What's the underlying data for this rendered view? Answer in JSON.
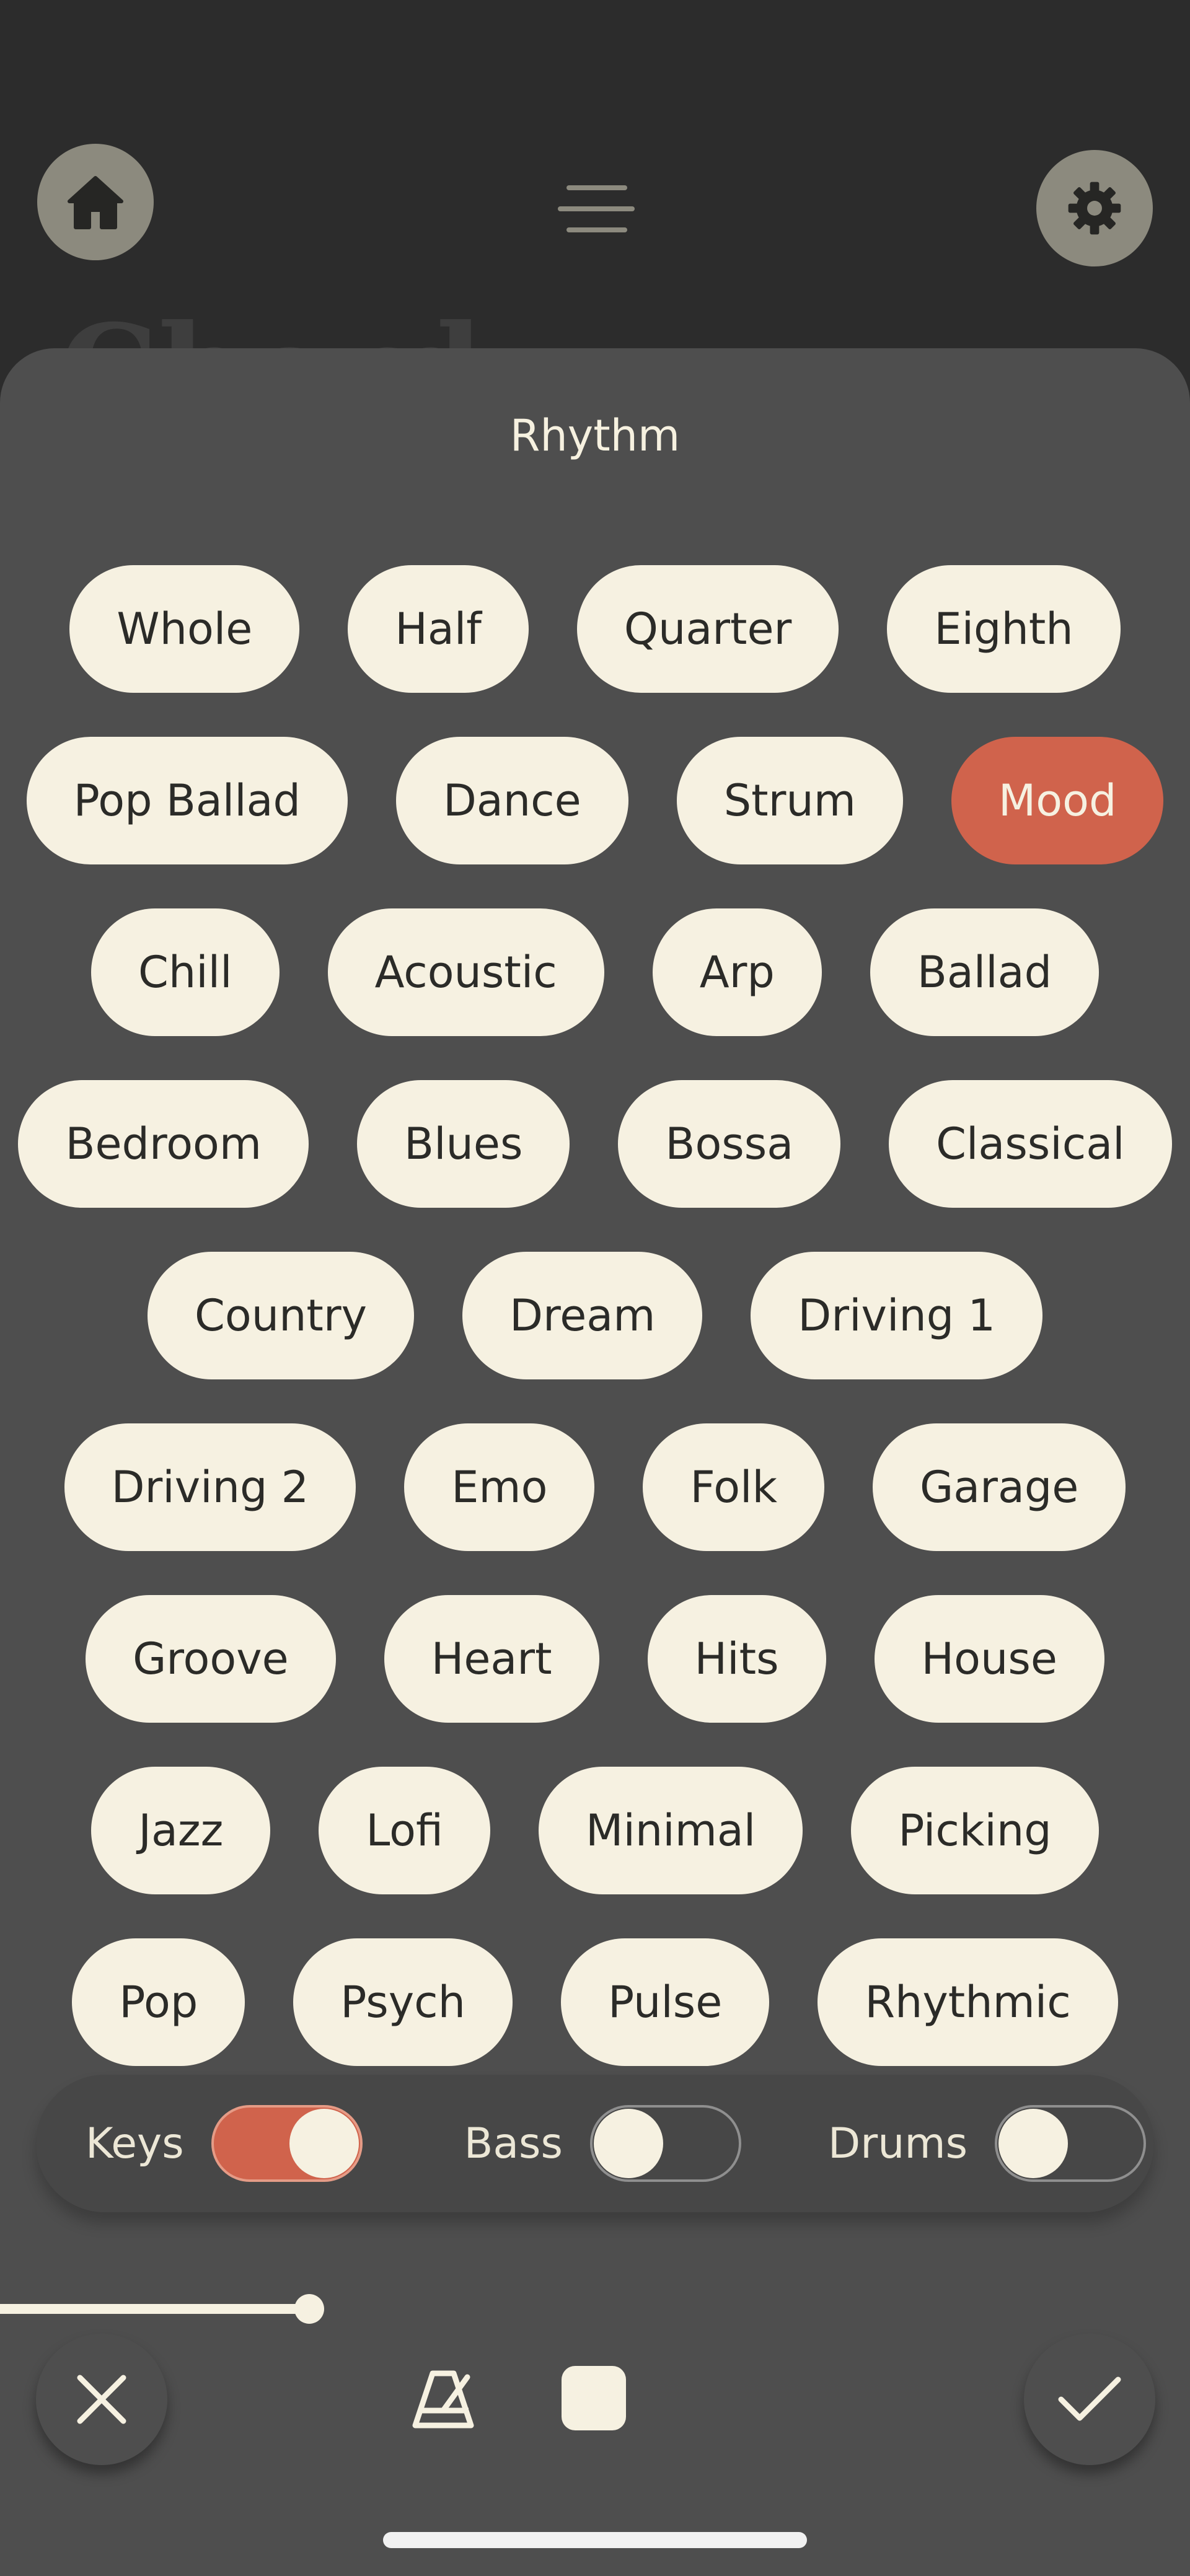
{
  "header": {
    "home_icon": "home-icon",
    "menu_icon": "hamburger-menu-icon",
    "settings_icon": "gear-icon",
    "background_title": "Chord"
  },
  "sheet": {
    "title": "Rhythm",
    "rows": [
      [
        {
          "label": "Whole",
          "selected": false
        },
        {
          "label": "Half",
          "selected": false
        },
        {
          "label": "Quarter",
          "selected": false
        },
        {
          "label": "Eighth",
          "selected": false
        }
      ],
      [
        {
          "label": "Pop Ballad",
          "selected": false
        },
        {
          "label": "Dance",
          "selected": false
        },
        {
          "label": "Strum",
          "selected": false
        },
        {
          "label": "Mood",
          "selected": true
        }
      ],
      [
        {
          "label": "Chill",
          "selected": false
        },
        {
          "label": "Acoustic",
          "selected": false
        },
        {
          "label": "Arp",
          "selected": false
        },
        {
          "label": "Ballad",
          "selected": false
        }
      ],
      [
        {
          "label": "Bedroom",
          "selected": false
        },
        {
          "label": "Blues",
          "selected": false
        },
        {
          "label": "Bossa",
          "selected": false
        },
        {
          "label": "Classical",
          "selected": false
        }
      ],
      [
        {
          "label": "Country",
          "selected": false
        },
        {
          "label": "Dream",
          "selected": false
        },
        {
          "label": "Driving 1",
          "selected": false
        }
      ],
      [
        {
          "label": "Driving 2",
          "selected": false
        },
        {
          "label": "Emo",
          "selected": false
        },
        {
          "label": "Folk",
          "selected": false
        },
        {
          "label": "Garage",
          "selected": false
        }
      ],
      [
        {
          "label": "Groove",
          "selected": false
        },
        {
          "label": "Heart",
          "selected": false
        },
        {
          "label": "Hits",
          "selected": false
        },
        {
          "label": "House",
          "selected": false
        }
      ],
      [
        {
          "label": "Jazz",
          "selected": false
        },
        {
          "label": "Lofi",
          "selected": false
        },
        {
          "label": "Minimal",
          "selected": false
        },
        {
          "label": "Picking",
          "selected": false
        }
      ],
      [
        {
          "label": "Pop",
          "selected": false
        },
        {
          "label": "Psych",
          "selected": false
        },
        {
          "label": "Pulse",
          "selected": false
        },
        {
          "label": "Rhythmic",
          "selected": false
        }
      ]
    ]
  },
  "toggles": {
    "keys": {
      "label": "Keys",
      "on": true
    },
    "bass": {
      "label": "Bass",
      "on": false
    },
    "drums": {
      "label": "Drums",
      "on": false
    }
  },
  "slider": {
    "value_fraction": 0.26
  },
  "footer": {
    "close_icon": "close-icon",
    "metronome_icon": "metronome-icon",
    "stop_icon": "stop-icon",
    "confirm_icon": "checkmark-icon"
  },
  "colors": {
    "accent": "#d0634c",
    "chip": "#f6f1e1",
    "sheet": "#4e4e4e",
    "background": "#2c2c2c"
  }
}
